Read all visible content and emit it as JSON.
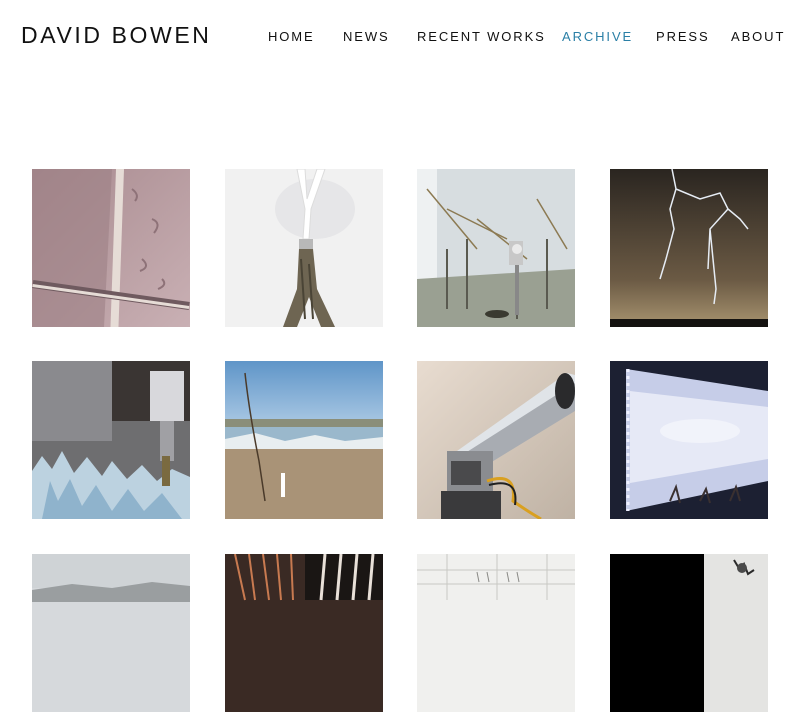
{
  "site": {
    "title": "DAVID BOWEN"
  },
  "nav": {
    "items": [
      {
        "label": "HOME",
        "active": false
      },
      {
        "label": "NEWS",
        "active": false
      },
      {
        "label": "RECENT WORKS",
        "active": false
      },
      {
        "label": "ARCHIVE",
        "active": true
      },
      {
        "label": "PRESS",
        "active": false
      },
      {
        "label": "ABOUT",
        "active": false
      }
    ],
    "active_color": "#2a7fa6"
  },
  "gallery": {
    "thumbnails": [
      {
        "subject": "textured-wall-with-rails"
      },
      {
        "subject": "branch-sculpture-on-white"
      },
      {
        "subject": "robotic-installation-room"
      },
      {
        "subject": "lightning-night-sky"
      },
      {
        "subject": "crystal-milling-machine"
      },
      {
        "subject": "beach-stick-installation"
      },
      {
        "subject": "robotic-revolver"
      },
      {
        "subject": "glowing-wall-screen"
      },
      {
        "subject": "gray-landscape"
      },
      {
        "subject": "wired-electronics"
      },
      {
        "subject": "gallery-ceiling-lights"
      },
      {
        "subject": "black-and-white-abstract"
      }
    ]
  }
}
